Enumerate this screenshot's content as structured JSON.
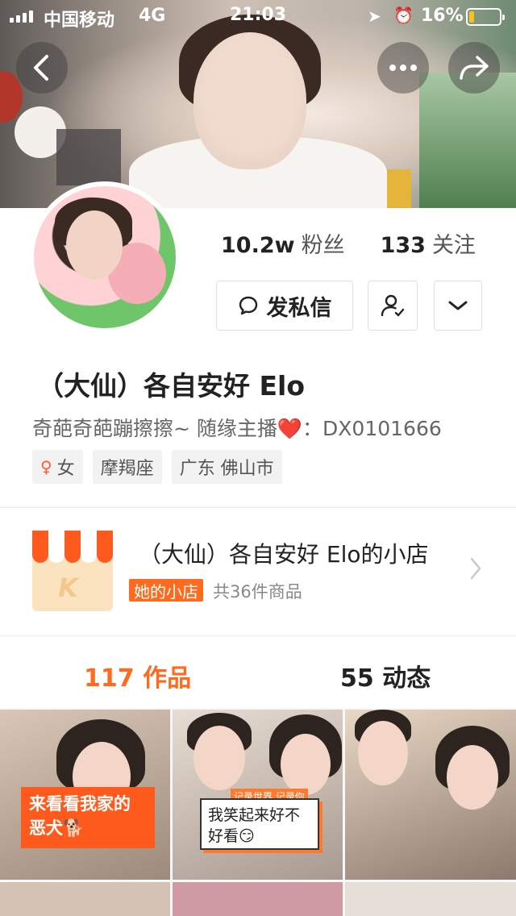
{
  "status_bar": {
    "carrier": "中国移动",
    "network": "4G",
    "time": "21:03",
    "battery": "16%",
    "battery_level": 0.16
  },
  "profile": {
    "followers_count": "10.2w",
    "followers_label": "粉丝",
    "following_count": "133",
    "following_label": "关注",
    "message_button": "发私信",
    "name": "（大仙）各自安好 Elo",
    "bio_prefix": "奇葩奇葩蹦擦擦~   随缘主播",
    "bio_suffix": "：DX0101666",
    "tags": [
      "女",
      "摩羯座",
      "广东 佛山市"
    ]
  },
  "shop": {
    "name": "（大仙）各自安好 Elo的小店",
    "badge": "她的小店",
    "count": "共36件商品",
    "logo_letter": "K"
  },
  "tabs": {
    "works_count": "117",
    "works_label": "作品",
    "moments_count": "55",
    "moments_label": "动态"
  },
  "grid": {
    "caption1": "来看看我家的恶犬🐕",
    "caption2_tag": "记录世界 记录你",
    "caption2": "我笑起来好不好看😏"
  },
  "colors": {
    "accent": "#ff6a1f",
    "battery": "#f5c518"
  },
  "icons": {
    "back": "chevron-left-icon",
    "more": "more-dots-icon",
    "share": "share-icon",
    "message": "chat-bubble-icon",
    "follow": "user-check-icon",
    "expand": "chevron-down-icon",
    "gender": "female-icon",
    "shop_chevron": "chevron-right-icon"
  }
}
